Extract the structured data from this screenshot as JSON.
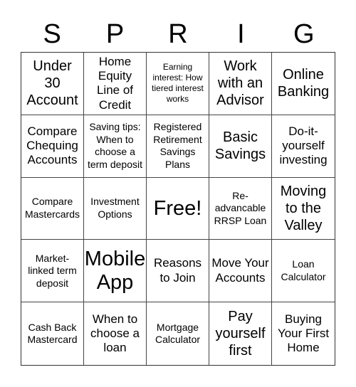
{
  "title_letters": [
    "S",
    "P",
    "R",
    "I",
    "G"
  ],
  "cells": [
    [
      {
        "text": "Under 30 Account",
        "size": "s-l"
      },
      {
        "text": "Home Equity Line of Credit",
        "size": "s-m"
      },
      {
        "text": "Earning interest: How tiered interest works",
        "size": "s-xs"
      },
      {
        "text": "Work with an Advisor",
        "size": "s-l"
      },
      {
        "text": "Online Banking",
        "size": "s-l"
      }
    ],
    [
      {
        "text": "Compare Chequing Accounts",
        "size": "s-m"
      },
      {
        "text": "Saving tips: When to choose a term deposit",
        "size": "s-s"
      },
      {
        "text": "Registered Retirement Savings Plans",
        "size": "s-s"
      },
      {
        "text": "Basic Savings",
        "size": "s-l"
      },
      {
        "text": "Do-it-yourself investing",
        "size": "s-m"
      }
    ],
    [
      {
        "text": "Compare Mastercards",
        "size": "s-s"
      },
      {
        "text": "Investment Options",
        "size": "s-s"
      },
      {
        "text": "Free!",
        "size": "s-xl"
      },
      {
        "text": "Re-advancable RRSP Loan",
        "size": "s-s"
      },
      {
        "text": "Moving to the Valley",
        "size": "s-l"
      }
    ],
    [
      {
        "text": "Market-linked term deposit",
        "size": "s-s"
      },
      {
        "text": "Mobile App",
        "size": "s-xl"
      },
      {
        "text": "Reasons to Join",
        "size": "s-m"
      },
      {
        "text": "Move Your Accounts",
        "size": "s-m"
      },
      {
        "text": "Loan Calculator",
        "size": "s-s"
      }
    ],
    [
      {
        "text": "Cash Back Mastercard",
        "size": "s-s"
      },
      {
        "text": "When to choose a loan",
        "size": "s-m"
      },
      {
        "text": "Mortgage Calculator",
        "size": "s-s"
      },
      {
        "text": "Pay yourself first",
        "size": "s-l"
      },
      {
        "text": "Buying Your First Home",
        "size": "s-m"
      }
    ]
  ]
}
